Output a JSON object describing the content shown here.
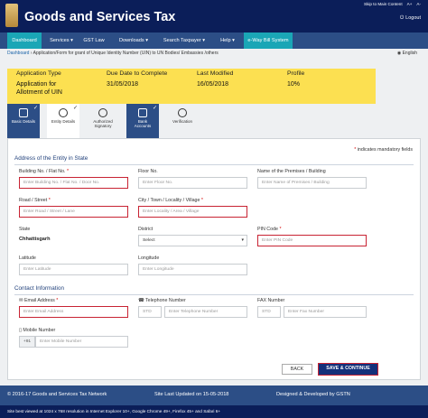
{
  "header": {
    "site_title": "Goods and Services Tax",
    "top_links": [
      "Skip to Main Content",
      "A+",
      "A-"
    ],
    "logout_label": "Logout"
  },
  "nav": {
    "items": [
      "Dashboard",
      "Services ▾",
      "GST Law",
      "Downloads ▾",
      "Search Taxpayer ▾",
      "Help ▾",
      "e-Way Bill System"
    ]
  },
  "breadcrumb": {
    "home": "Dashboard",
    "separator": "›",
    "current": "Application/Form for grant of Unique Identity Number (UIN) to UN Bodies/ Embassies /others",
    "language": "English"
  },
  "info": {
    "application_type_label": "Application Type",
    "application_type_value_line1": "Application for",
    "application_type_value_line2": "Allotment of UIN",
    "due_date_label": "Due Date to Complete",
    "due_date_value": "31/05/2018",
    "last_modified_label": "Last Modified",
    "last_modified_value": "16/05/2018",
    "profile_label": "Profile",
    "profile_value": "10%"
  },
  "steps": [
    {
      "label_line1": "Basic Details",
      "label_line2": "",
      "status": "done"
    },
    {
      "label_line1": "Entity Details",
      "label_line2": "",
      "status": "current"
    },
    {
      "label_line1": "Authorized",
      "label_line2": "Signatory",
      "status": "pending"
    },
    {
      "label_line1": "Bank",
      "label_line2": "Accounts",
      "status": "done"
    },
    {
      "label_line1": "Verification",
      "label_line2": "",
      "status": "pending"
    }
  ],
  "form": {
    "mandatory_note": "indicates mandatory fields",
    "mandatory_mark": "*",
    "section_address": "Address of the Entity in State",
    "building_label": "Building No. / Flat No.",
    "building_placeholder": "Enter Building No. / Flat No. / Door No.",
    "floor_label": "Floor No.",
    "floor_placeholder": "Enter Floor No.",
    "premises_label": "Name of the Premises / Building",
    "premises_placeholder": "Enter Name of Premises / Building",
    "road_label": "Road / Street",
    "road_placeholder": "Enter Road / Street / Lane",
    "city_label": "City / Town / Locality / Village",
    "city_placeholder": "Enter Locality / Area / Village",
    "state_label": "State",
    "state_value": "Chhattisgarh",
    "district_label": "District",
    "district_value": "Select",
    "pin_label": "PIN Code",
    "pin_placeholder": "Enter PIN Code",
    "latitude_label": "Latitude",
    "latitude_placeholder": "Enter Latitude",
    "longitude_label": "Longitude",
    "longitude_placeholder": "Enter Longitude",
    "section_contact": "Contact Information",
    "email_label": "Email Address",
    "email_placeholder": "Enter Email Address",
    "tel_label": "Telephone Number",
    "tel_std_placeholder": "STD",
    "tel_placeholder": "Enter Telephone Number",
    "fax_label": "FAX Number",
    "fax_std_placeholder": "STD",
    "fax_placeholder": "Enter Fax Number",
    "mobile_label": "Mobile Number",
    "mobile_prefix": "+91",
    "mobile_placeholder": "Enter Mobile Number",
    "back_label": "BACK",
    "save_label": "SAVE & CONTINUE"
  },
  "footer": {
    "copyright": "© 2016-17 Goods and Services Tax Network",
    "last_updated": "Site Last Updated on 15-05-2018",
    "designed_by": "Designed & Developed by GSTN",
    "browser_note": "Site best viewed at 1024 x 768 resolution in Internet Explorer 10+, Google Chrome 49+, Firefox 45+ and Safari 6+"
  },
  "colors": {
    "header_bg": "#0b1e59",
    "nav_bg": "#2c4e86",
    "active_tab": "#1aa6b6",
    "info_bar": "#fce051",
    "error_border": "#c82333"
  }
}
